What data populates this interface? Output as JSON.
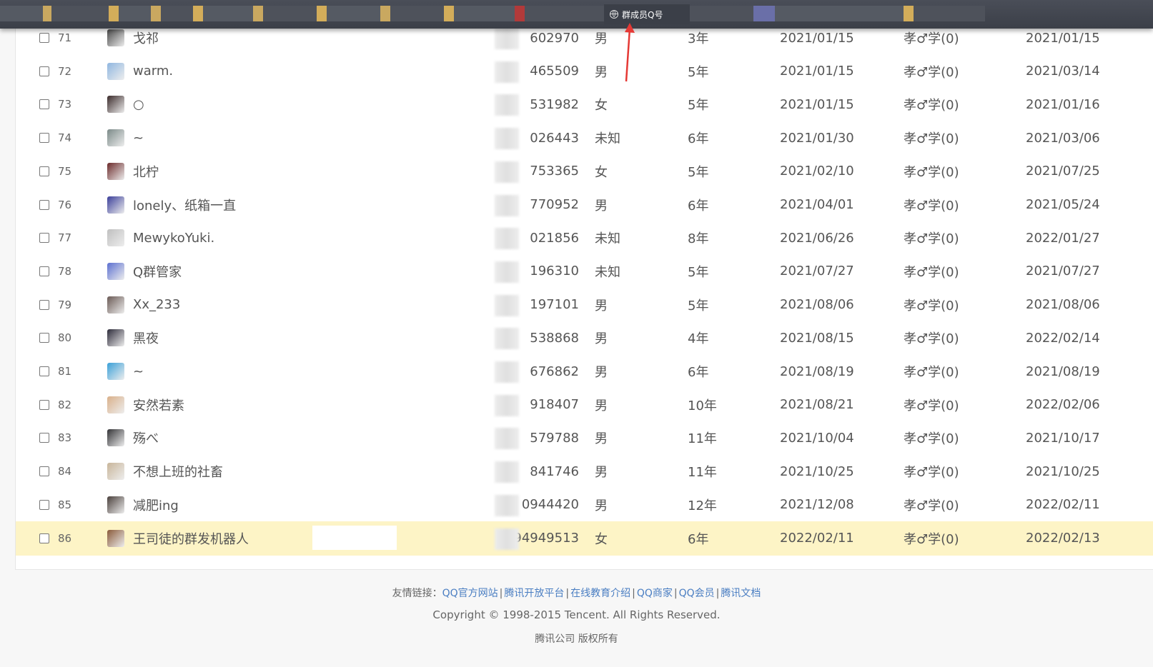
{
  "browser": {
    "active_tab_title": "群成员Q号"
  },
  "colors": {
    "highlight_row": "#fdf4c6",
    "link": "#4a7ec2",
    "arrow": "#e53935"
  },
  "rows": [
    {
      "index": "71",
      "nickname": "戈祁",
      "qq": "602970",
      "gender": "男",
      "qage": "3年",
      "join_date": "2021/01/15",
      "level": "孝♂学(0)",
      "last_speak": "2021/01/15",
      "avatar": "#4a4a4a"
    },
    {
      "index": "72",
      "nickname": "warm.",
      "qq": "465509",
      "gender": "男",
      "qage": "5年",
      "join_date": "2021/01/15",
      "level": "孝♂学(0)",
      "last_speak": "2021/03/14",
      "avatar": "#8fb6e0"
    },
    {
      "index": "73",
      "nickname": "○",
      "qq": "531982",
      "gender": "女",
      "qage": "5年",
      "join_date": "2021/01/15",
      "level": "孝♂学(0)",
      "last_speak": "2021/01/16",
      "avatar": "#3a2a2a"
    },
    {
      "index": "74",
      "nickname": "~",
      "qq": "026443",
      "gender": "未知",
      "qage": "6年",
      "join_date": "2021/01/30",
      "level": "孝♂学(0)",
      "last_speak": "2021/03/06",
      "avatar": "#7b8a88"
    },
    {
      "index": "75",
      "nickname": "北柠",
      "qq": "753365",
      "gender": "女",
      "qage": "5年",
      "join_date": "2021/02/10",
      "level": "孝♂学(0)",
      "last_speak": "2021/07/25",
      "avatar": "#6b2a2a"
    },
    {
      "index": "76",
      "nickname": "lonely、纸箱一直",
      "qq": "770952",
      "gender": "男",
      "qage": "6年",
      "join_date": "2021/04/01",
      "level": "孝♂学(0)",
      "last_speak": "2021/05/24",
      "avatar": "#3b3f9a"
    },
    {
      "index": "77",
      "nickname": "MewykoYuki.",
      "qq": "021856",
      "gender": "未知",
      "qage": "8年",
      "join_date": "2021/06/26",
      "level": "孝♂学(0)",
      "last_speak": "2022/01/27",
      "avatar": "#bfbfbf"
    },
    {
      "index": "78",
      "nickname": "Q群管家",
      "qq": "196310",
      "gender": "未知",
      "qage": "5年",
      "join_date": "2021/07/27",
      "level": "孝♂学(0)",
      "last_speak": "2021/07/27",
      "avatar": "#5b6fd0"
    },
    {
      "index": "79",
      "nickname": "Xx_233",
      "qq": "197101",
      "gender": "男",
      "qage": "5年",
      "join_date": "2021/08/06",
      "level": "孝♂学(0)",
      "last_speak": "2021/08/06",
      "avatar": "#6a5a55"
    },
    {
      "index": "80",
      "nickname": "黑夜",
      "qq": "538868",
      "gender": "男",
      "qage": "4年",
      "join_date": "2021/08/15",
      "level": "孝♂学(0)",
      "last_speak": "2022/02/14",
      "avatar": "#2d2b3a"
    },
    {
      "index": "81",
      "nickname": "~",
      "qq": "676862",
      "gender": "男",
      "qage": "6年",
      "join_date": "2021/08/19",
      "level": "孝♂学(0)",
      "last_speak": "2021/08/19",
      "avatar": "#3aa0d8"
    },
    {
      "index": "82",
      "nickname": "安然若素",
      "qq": "918407",
      "gender": "男",
      "qage": "10年",
      "join_date": "2021/08/21",
      "level": "孝♂学(0)",
      "last_speak": "2022/02/06",
      "avatar": "#d9b08a"
    },
    {
      "index": "83",
      "nickname": "殇べ",
      "qq": "579788",
      "gender": "男",
      "qage": "11年",
      "join_date": "2021/10/04",
      "level": "孝♂学(0)",
      "last_speak": "2021/10/17",
      "avatar": "#333336"
    },
    {
      "index": "84",
      "nickname": "不想上班的社畜",
      "qq": "841746",
      "gender": "男",
      "qage": "11年",
      "join_date": "2021/10/25",
      "level": "孝♂学(0)",
      "last_speak": "2021/10/25",
      "avatar": "#c8b59a"
    },
    {
      "index": "85",
      "nickname": "减肥ing",
      "qq": "0944420",
      "gender": "男",
      "qage": "12年",
      "join_date": "2021/12/08",
      "level": "孝♂学(0)",
      "last_speak": "2022/02/11",
      "avatar": "#4a403c"
    },
    {
      "index": "86",
      "nickname": "王司徒的群发机器人",
      "qq": "94949513",
      "gender": "女",
      "qage": "6年",
      "join_date": "2022/02/11",
      "level": "孝♂学(0)",
      "last_speak": "2022/02/13",
      "avatar": "#8a5a3a"
    }
  ],
  "footer": {
    "links_label": "友情链接：",
    "links": [
      "QQ官方网站",
      "腾讯开放平台",
      "在线教育介绍",
      "QQ商家",
      "QQ会员",
      "腾讯文档"
    ],
    "separator": "|",
    "copyright": "Copyright © 1998-2015 Tencent. All Rights Reserved.",
    "company": "腾讯公司 版权所有"
  }
}
